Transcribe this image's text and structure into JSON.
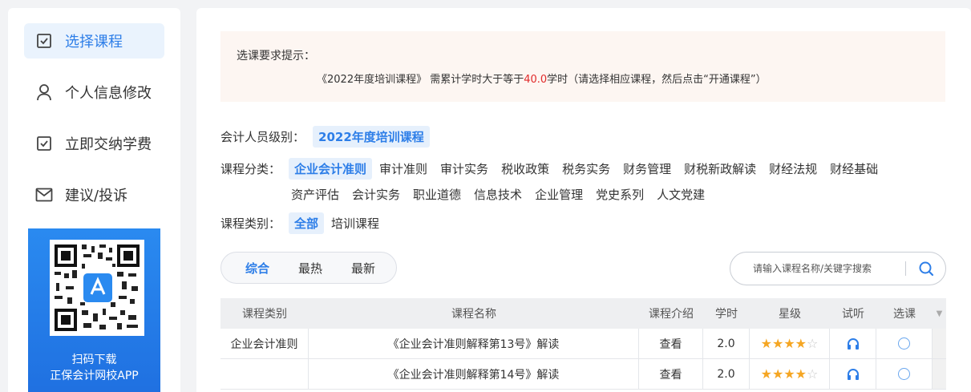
{
  "sidebar": {
    "items": [
      {
        "label": "选择课程",
        "icon": "checkbox-icon"
      },
      {
        "label": "个人信息修改",
        "icon": "user-icon"
      },
      {
        "label": "立即交纳学费",
        "icon": "checkbox-icon"
      },
      {
        "label": "建议/投诉",
        "icon": "mail-icon"
      }
    ],
    "qr": {
      "line1": "扫码下载",
      "line2": "正保会计网校APP"
    }
  },
  "notice": {
    "title": "选课要求提示：",
    "body_prefix": "《2022年度培训课程》 需累计学时大于等于",
    "body_highlight": "40.0",
    "body_suffix": "学时（请选择相应课程，然后点击“开通课程”）"
  },
  "filters": {
    "level": {
      "label": "会计人员级别：",
      "options": [
        "2022年度培训课程"
      ]
    },
    "category": {
      "label": "课程分类：",
      "options": [
        "企业会计准则",
        "审计准则",
        "审计实务",
        "税收政策",
        "税务实务",
        "财务管理",
        "财税新政解读",
        "财经法规",
        "财经基础",
        "资产评估",
        "会计实务",
        "职业道德",
        "信息技术",
        "企业管理",
        "党史系列",
        "人文党建"
      ]
    },
    "type": {
      "label": "课程类别：",
      "options": [
        "全部",
        "培训课程"
      ]
    }
  },
  "sort": [
    "综合",
    "最热",
    "最新"
  ],
  "search": {
    "placeholder": "请输入课程名称/关键字搜索"
  },
  "table": {
    "headers": [
      "课程类别",
      "课程名称",
      "课程介绍",
      "学时",
      "星级",
      "试听",
      "选课"
    ],
    "rows": [
      {
        "category": "企业会计准则",
        "name": "《企业会计准则解释第13号》解读",
        "intro": "查看",
        "hours": "2.0",
        "stars": 4
      },
      {
        "category": "",
        "name": "《企业会计准则解释第14号》解读",
        "intro": "查看",
        "hours": "2.0",
        "stars": 4
      }
    ]
  },
  "colors": {
    "accent": "#2d7ee8",
    "highlight": "#e02a2a",
    "star": "#f5a623"
  }
}
